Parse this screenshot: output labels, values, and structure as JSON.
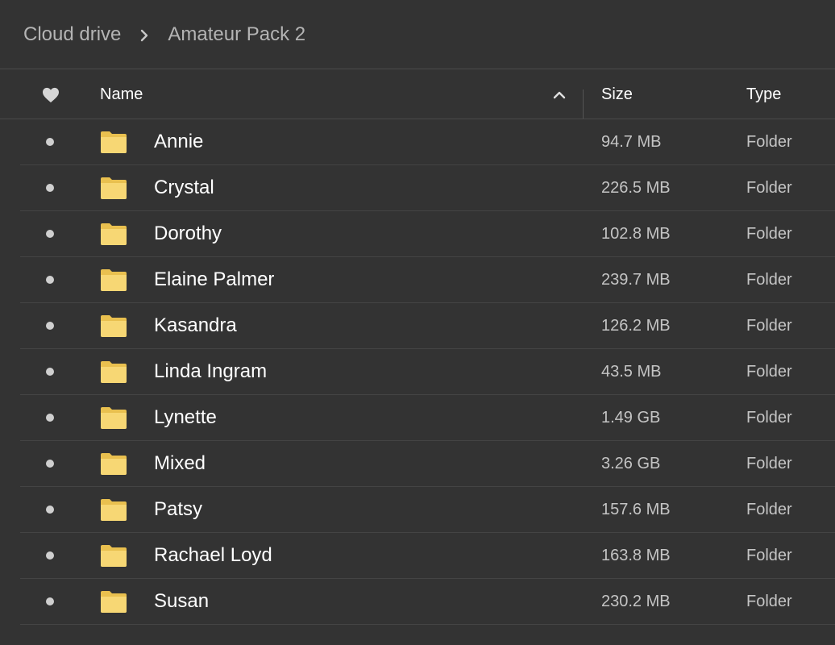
{
  "breadcrumb": {
    "root": "Cloud drive",
    "separator_icon": "chevron-right-icon",
    "current": "Amateur Pack 2"
  },
  "table": {
    "columns": {
      "favorite_icon": "heart-icon",
      "name": "Name",
      "sort_icon": "chevron-up-icon",
      "size": "Size",
      "type": "Type"
    },
    "rows": [
      {
        "name": "Annie",
        "size": "94.7 MB",
        "type": "Folder"
      },
      {
        "name": "Crystal",
        "size": "226.5 MB",
        "type": "Folder"
      },
      {
        "name": "Dorothy",
        "size": "102.8 MB",
        "type": "Folder"
      },
      {
        "name": "Elaine Palmer",
        "size": "239.7 MB",
        "type": "Folder"
      },
      {
        "name": "Kasandra",
        "size": "126.2 MB",
        "type": "Folder"
      },
      {
        "name": "Linda Ingram",
        "size": "43.5 MB",
        "type": "Folder"
      },
      {
        "name": "Lynette",
        "size": "1.49 GB",
        "type": "Folder"
      },
      {
        "name": "Mixed",
        "size": "3.26 GB",
        "type": "Folder"
      },
      {
        "name": "Patsy",
        "size": "157.6 MB",
        "type": "Folder"
      },
      {
        "name": "Rachael Loyd",
        "size": "163.8 MB",
        "type": "Folder"
      },
      {
        "name": "Susan",
        "size": "230.2 MB",
        "type": "Folder"
      }
    ]
  },
  "colors": {
    "background": "#333333",
    "folder_fill": "#f7d774",
    "folder_tab": "#e9c04f",
    "divider": "#444444"
  }
}
